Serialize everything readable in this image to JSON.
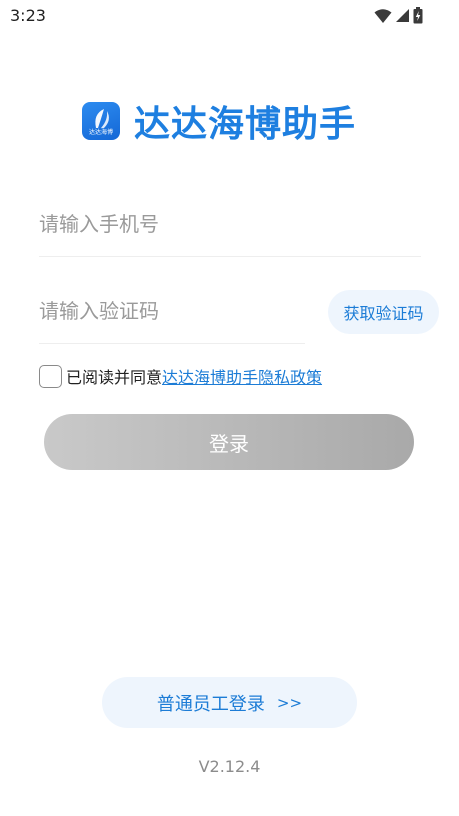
{
  "status_bar": {
    "time": "3:23",
    "icons": [
      "wifi-icon",
      "cellular-signal-icon",
      "battery-charging-icon"
    ]
  },
  "brand": {
    "logo_caption": "达达海博",
    "title": "达达海博助手",
    "color": "#1e7fe0"
  },
  "form": {
    "phone_placeholder": "请输入手机号",
    "phone_value": "",
    "code_placeholder": "请输入验证码",
    "code_value": "",
    "get_code_label": "获取验证码",
    "agree_checked": false,
    "agree_text": "已阅读并同意",
    "policy_link": "达达海博助手隐私政策",
    "login_label": "登录"
  },
  "footer": {
    "staff_login_label": "普通员工登录",
    "staff_login_arrow": ">>",
    "version": "V2.12.4"
  },
  "colors": {
    "accent": "#1c7cd6",
    "button_disabled": "#b9b9b9",
    "soft_blue_bg": "#eef5fd"
  }
}
